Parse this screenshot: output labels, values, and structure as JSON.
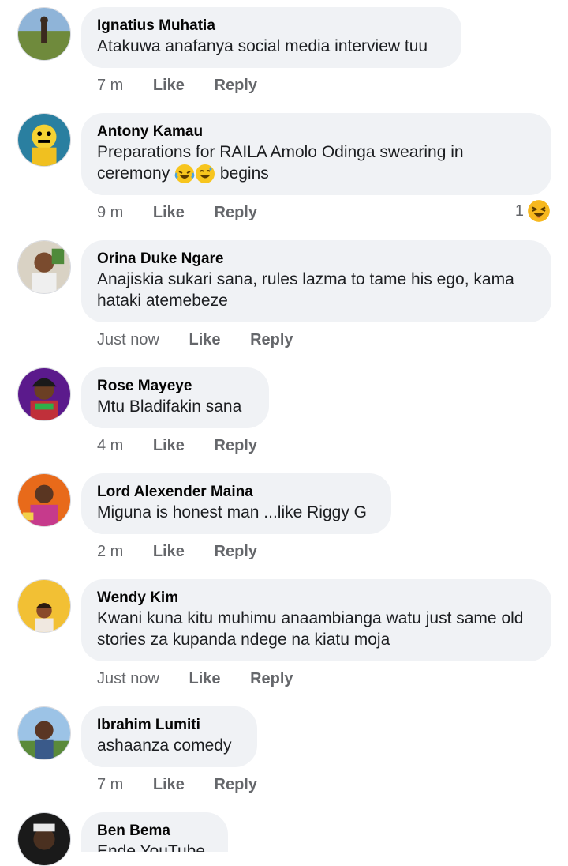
{
  "labels": {
    "like": "Like",
    "reply": "Reply"
  },
  "comments": [
    {
      "author": "Ignatius Muhatia",
      "text": "Atakuwa anafanya social media interview tuu",
      "time": "7 m"
    },
    {
      "author": "Antony Kamau",
      "text_before": "Preparations for RAILA Amolo Odinga swearing in ceremony",
      "text_after": "begins",
      "emojis": [
        "crying-laughing-emoji",
        "grinning-sweat-emoji"
      ],
      "time": "9 m",
      "reaction_count": "1",
      "reaction_icon": "laughing-emoji"
    },
    {
      "author": "Orina Duke Ngare",
      "text": "Anajiskia sukari sana, rules lazma to tame his ego, kama hataki atemebeze",
      "time": "Just now"
    },
    {
      "author": "Rose Mayeye",
      "text": "Mtu Bladifakin sana",
      "time": "4 m"
    },
    {
      "author": "Lord Alexender Maina",
      "text": "Miguna is honest man ...like Riggy G",
      "time": "2 m"
    },
    {
      "author": "Wendy Kim",
      "text": "Kwani kuna kitu muhimu anaambianga watu just same old stories za kupanda ndege na kiatu moja",
      "time": "Just now"
    },
    {
      "author": "Ibrahim Lumiti",
      "text": "ashaanza comedy",
      "time": "7 m"
    },
    {
      "author": "Ben Bema",
      "text": "Ende YouTube"
    }
  ]
}
